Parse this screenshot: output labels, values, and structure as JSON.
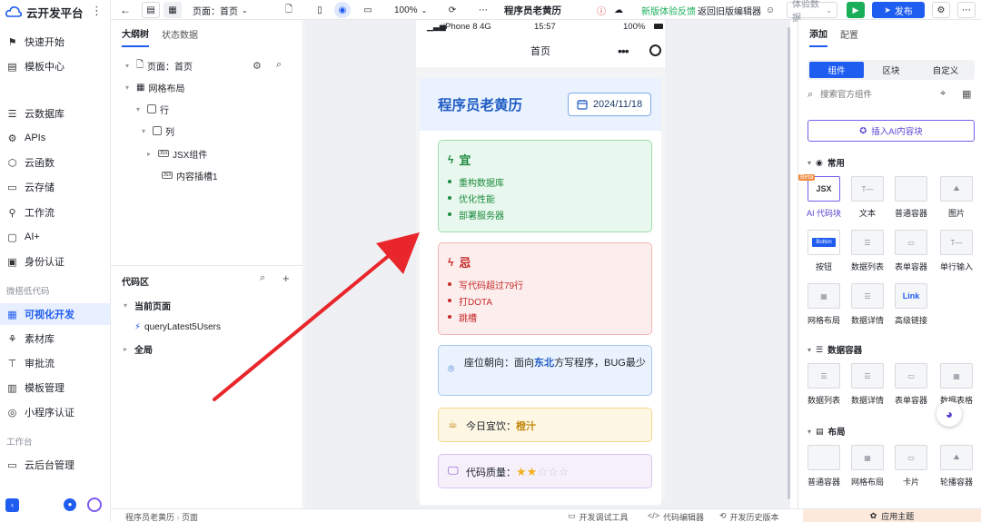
{
  "sidebar": {
    "brand": "云开发平台",
    "items": [
      {
        "label": "快速开始",
        "icon": "flag-icon"
      },
      {
        "label": "模板中心",
        "icon": "template-icon"
      },
      {
        "label": "云数据库",
        "icon": "database-icon"
      },
      {
        "label": "APIs",
        "icon": "api-icon"
      },
      {
        "label": "云函数",
        "icon": "function-icon"
      },
      {
        "label": "云存储",
        "icon": "folder-icon"
      },
      {
        "label": "工作流",
        "icon": "workflow-icon"
      },
      {
        "label": "AI+",
        "icon": "ai-icon"
      },
      {
        "label": "身份认证",
        "icon": "id-card-icon"
      }
    ],
    "section_lowcode": "微搭低代码",
    "lowcode_items": [
      {
        "label": "可视化开发",
        "icon": "visual-dev-icon",
        "active": true
      },
      {
        "label": "素材库",
        "icon": "material-icon"
      },
      {
        "label": "审批流",
        "icon": "approval-icon"
      },
      {
        "label": "模板管理",
        "icon": "template-manage-icon"
      },
      {
        "label": "小程序认证",
        "icon": "miniprogram-icon"
      }
    ],
    "section_workbench": "工作台",
    "workbench_items": [
      {
        "label": "云后台管理",
        "icon": "admin-icon"
      }
    ]
  },
  "tree_panel": {
    "tabs": [
      "大纲树",
      "状态数据"
    ],
    "nodes": [
      {
        "label": "页面：首页",
        "indent": 0
      },
      {
        "label": "网格布局",
        "indent": 1
      },
      {
        "label": "行",
        "indent": 2
      },
      {
        "label": "列",
        "indent": 3
      },
      {
        "label": "JSX组件",
        "indent": 4
      },
      {
        "label": "内容插槽1",
        "indent": 5
      }
    ],
    "code_area_title": "代码区",
    "code_current_page": "当前页面",
    "code_query": "queryLatest5Users",
    "code_global": "全局"
  },
  "toolbar": {
    "page_selector": "页面：首页",
    "zoom": "100%",
    "app_name": "程序员老黄历",
    "feedback": "新版体验反馈",
    "old_editor": "返回旧版编辑器",
    "env_select": "体验数据",
    "publish": "发布"
  },
  "phone": {
    "status_left": "iPhone 8  4G",
    "time": "15:57",
    "battery": "100%",
    "nav_title": "首页"
  },
  "calendar": {
    "title": "程序员老黄历",
    "date": "2024/11/18",
    "yi_title": "宜",
    "yi_items": [
      "重构数据库",
      "优化性能",
      "部署服务器"
    ],
    "ji_title": "忌",
    "ji_items": [
      "写代码超过79行",
      "打DOTA",
      "跳槽"
    ],
    "direction_prefix": "座位朝向：面向",
    "direction_value": "东北",
    "direction_suffix": "方写程序，BUG最少",
    "drink_prefix": "今日宜饮：",
    "drink_value": "橙汁",
    "quality_label": "代码质量：",
    "quality_stars": 2,
    "quality_max": 5
  },
  "right_panel": {
    "tabs": [
      "添加",
      "配置"
    ],
    "segments": [
      "组件",
      "区块",
      "自定义"
    ],
    "search_placeholder": "搜索官方组件",
    "ai_insert": "插入AI内容块",
    "sec_common": "常用",
    "common": [
      {
        "label": "AI 代码块",
        "thumb": "JSX",
        "badge": "Beta"
      },
      {
        "label": "文本",
        "thumb": ""
      },
      {
        "label": "普通容器",
        "thumb": ""
      },
      {
        "label": "图片",
        "thumb": ""
      },
      {
        "label": "按钮",
        "thumb": "Button"
      },
      {
        "label": "数据列表",
        "thumb": ""
      },
      {
        "label": "表单容器",
        "thumb": ""
      },
      {
        "label": "单行输入",
        "thumb": ""
      },
      {
        "label": "网格布局",
        "thumb": ""
      },
      {
        "label": "数据详情",
        "thumb": ""
      },
      {
        "label": "高级链接",
        "thumb": "Link"
      }
    ],
    "sec_data": "数据容器",
    "data": [
      "数据列表",
      "数据详情",
      "表单容器",
      "数据表格"
    ],
    "sec_layout": "布局",
    "layout": [
      "普通容器",
      "网格布局",
      "卡片",
      "轮播容器"
    ]
  },
  "bottombar": {
    "breadcrumb": [
      "程序员老黄历",
      "页面"
    ],
    "debug": "开发调试工具",
    "code_editor": "代码编辑器",
    "history": "开发历史版本",
    "theme": "应用主题"
  },
  "colors": {
    "accent": "#1f5cf0",
    "publish_green": "#1aad5a",
    "arrow_red": "#e8262b"
  }
}
